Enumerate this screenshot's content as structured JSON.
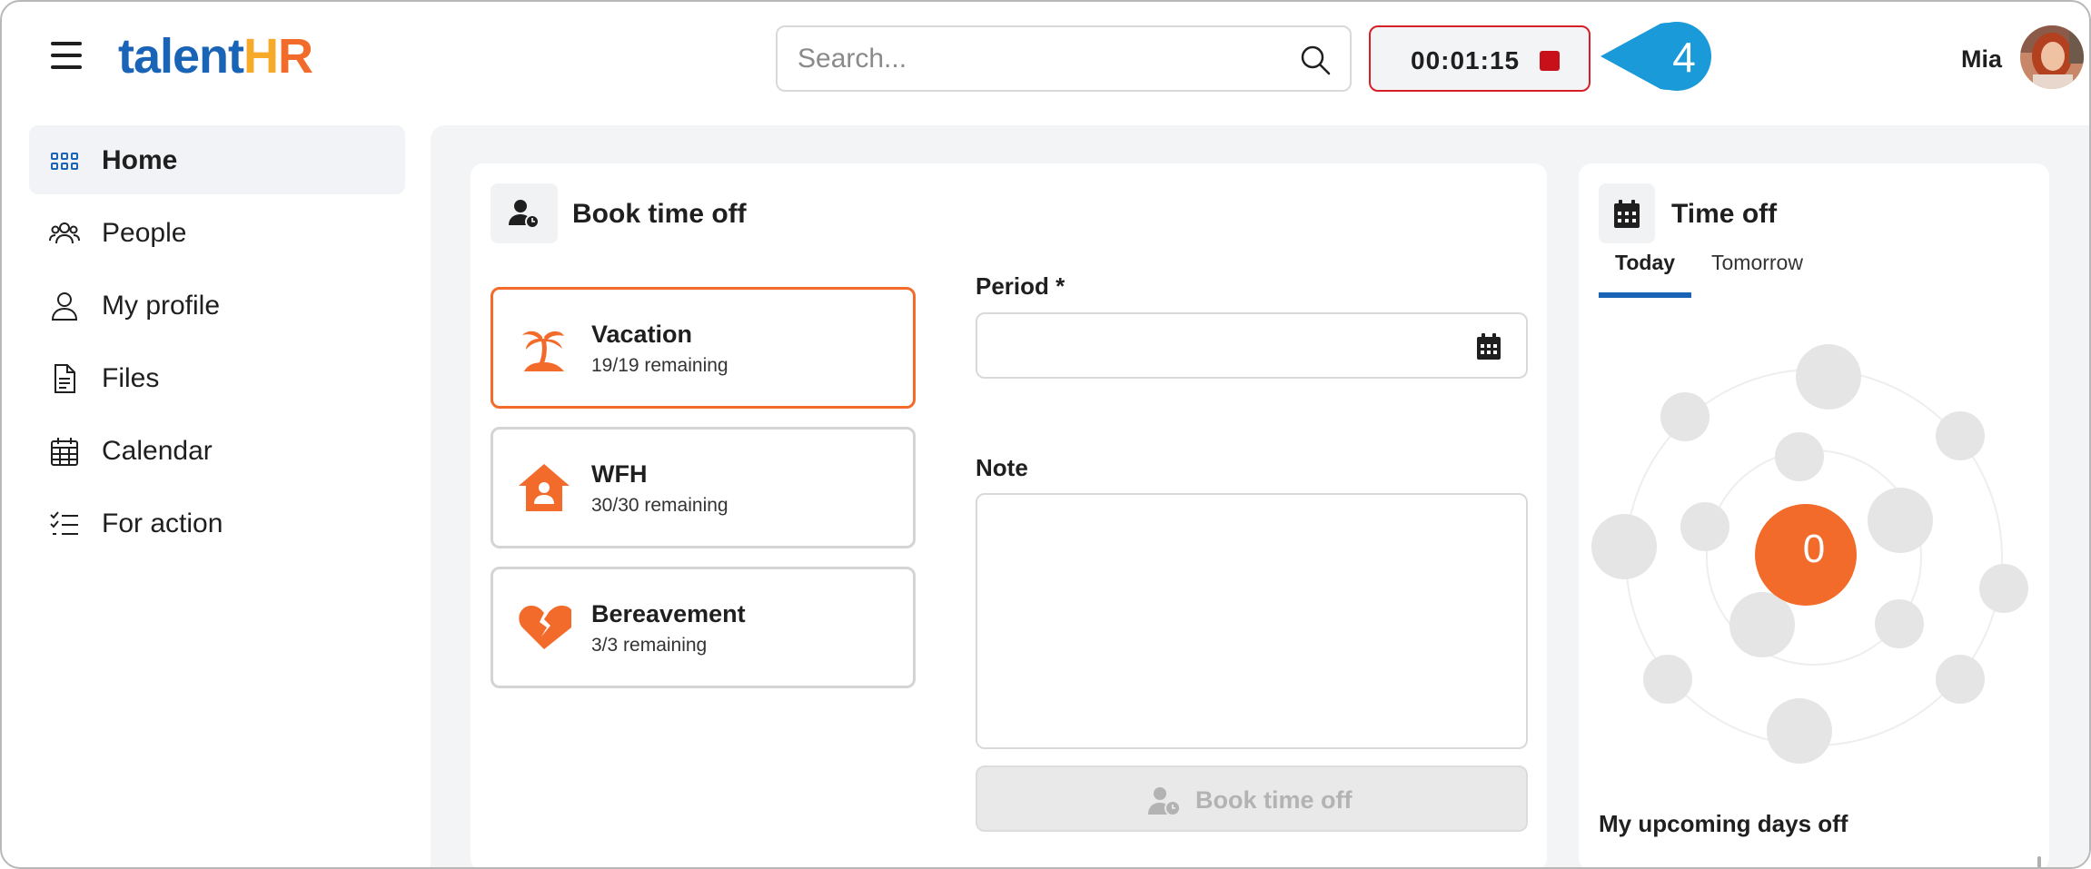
{
  "header": {
    "logo_part1": "talent",
    "logo_part2": "H",
    "logo_part3": "R",
    "search_placeholder": "Search...",
    "timer": "00:01:15",
    "callout_number": "4",
    "user_name": "Mia"
  },
  "sidebar": {
    "items": [
      {
        "label": "Home",
        "icon": "grid-icon",
        "active": true
      },
      {
        "label": "People",
        "icon": "people-icon",
        "active": false
      },
      {
        "label": "My profile",
        "icon": "user-icon",
        "active": false
      },
      {
        "label": "Files",
        "icon": "file-icon",
        "active": false
      },
      {
        "label": "Calendar",
        "icon": "calendar-icon",
        "active": false
      },
      {
        "label": "For action",
        "icon": "checklist-icon",
        "active": false
      }
    ]
  },
  "book": {
    "title": "Book time off",
    "leave_types": [
      {
        "name": "Vacation",
        "remaining": "19/19 remaining",
        "icon": "palm-tree-icon",
        "selected": true
      },
      {
        "name": "WFH",
        "remaining": "30/30 remaining",
        "icon": "house-user-icon",
        "selected": false
      },
      {
        "name": "Bereavement",
        "remaining": "3/3 remaining",
        "icon": "broken-heart-icon",
        "selected": false
      }
    ],
    "period_label": "Period *",
    "note_label": "Note",
    "submit_label": "Book time off"
  },
  "time_off": {
    "title": "Time off",
    "tabs": [
      "Today",
      "Tomorrow"
    ],
    "active_tab": "Today",
    "count": "0",
    "upcoming_heading": "My upcoming days off"
  },
  "colors": {
    "brand_blue": "#1a64b8",
    "brand_orange": "#f26b2a",
    "brand_yellow": "#f7a928",
    "stop_red": "#c8101b",
    "callout_blue": "#1a9ad8"
  }
}
